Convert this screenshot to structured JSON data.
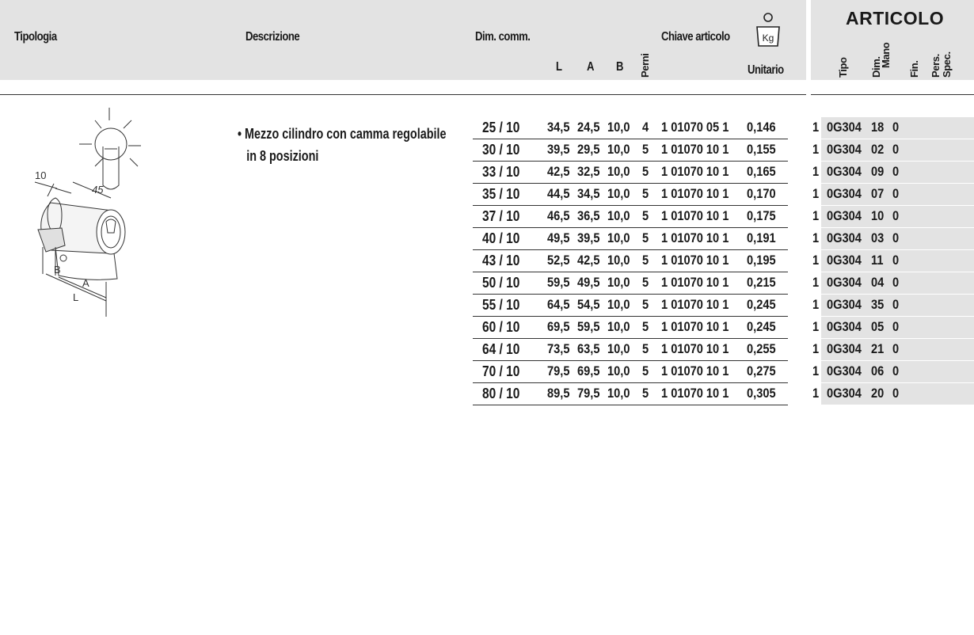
{
  "header": {
    "tipologia": "Tipologia",
    "descrizione": "Descrizione",
    "dim_comm": "Dim. comm.",
    "col_L": "L",
    "col_A": "A",
    "col_B": "B",
    "col_perni": "Perni",
    "chiave_articolo": "Chiave articolo",
    "unitario": "Unitario",
    "kg_icon_label": "Kg",
    "articolo": "ARTICOLO",
    "art_cols": [
      "Tipo",
      "Dim.",
      "Mano",
      "Fin.",
      "Pers.",
      "Spec."
    ]
  },
  "drawing_labels": {
    "dim10": "10",
    "dim45": "45",
    "B": "B",
    "A": "A",
    "L": "L"
  },
  "description": {
    "line1": "• Mezzo cilindro con camma regolabile",
    "line2": "in 8 posizioni"
  },
  "rows": [
    {
      "dim": "25 / 10",
      "L": "34,5",
      "A": "24,5",
      "B": "10,0",
      "perni": "4",
      "chiave": "1 01070 05 1",
      "unitario": "0,146",
      "q": "1",
      "tipo": "0G304",
      "dimart": "18",
      "x": "0"
    },
    {
      "dim": "30 / 10",
      "L": "39,5",
      "A": "29,5",
      "B": "10,0",
      "perni": "5",
      "chiave": "1 01070 10 1",
      "unitario": "0,155",
      "q": "1",
      "tipo": "0G304",
      "dimart": "02",
      "x": "0"
    },
    {
      "dim": "33 / 10",
      "L": "42,5",
      "A": "32,5",
      "B": "10,0",
      "perni": "5",
      "chiave": "1 01070 10 1",
      "unitario": "0,165",
      "q": "1",
      "tipo": "0G304",
      "dimart": "09",
      "x": "0"
    },
    {
      "dim": "35 / 10",
      "L": "44,5",
      "A": "34,5",
      "B": "10,0",
      "perni": "5",
      "chiave": "1 01070 10 1",
      "unitario": "0,170",
      "q": "1",
      "tipo": "0G304",
      "dimart": "07",
      "x": "0"
    },
    {
      "dim": "37 / 10",
      "L": "46,5",
      "A": "36,5",
      "B": "10,0",
      "perni": "5",
      "chiave": "1 01070 10 1",
      "unitario": "0,175",
      "q": "1",
      "tipo": "0G304",
      "dimart": "10",
      "x": "0"
    },
    {
      "dim": "40 / 10",
      "L": "49,5",
      "A": "39,5",
      "B": "10,0",
      "perni": "5",
      "chiave": "1 01070 10 1",
      "unitario": "0,191",
      "q": "1",
      "tipo": "0G304",
      "dimart": "03",
      "x": "0"
    },
    {
      "dim": "43 / 10",
      "L": "52,5",
      "A": "42,5",
      "B": "10,0",
      "perni": "5",
      "chiave": "1 01070 10 1",
      "unitario": "0,195",
      "q": "1",
      "tipo": "0G304",
      "dimart": "11",
      "x": "0"
    },
    {
      "dim": "50 / 10",
      "L": "59,5",
      "A": "49,5",
      "B": "10,0",
      "perni": "5",
      "chiave": "1 01070 10 1",
      "unitario": "0,215",
      "q": "1",
      "tipo": "0G304",
      "dimart": "04",
      "x": "0"
    },
    {
      "dim": "55 / 10",
      "L": "64,5",
      "A": "54,5",
      "B": "10,0",
      "perni": "5",
      "chiave": "1 01070 10 1",
      "unitario": "0,245",
      "q": "1",
      "tipo": "0G304",
      "dimart": "35",
      "x": "0"
    },
    {
      "dim": "60 / 10",
      "L": "69,5",
      "A": "59,5",
      "B": "10,0",
      "perni": "5",
      "chiave": "1 01070 10 1",
      "unitario": "0,245",
      "q": "1",
      "tipo": "0G304",
      "dimart": "05",
      "x": "0"
    },
    {
      "dim": "64 / 10",
      "L": "73,5",
      "A": "63,5",
      "B": "10,0",
      "perni": "5",
      "chiave": "1 01070 10 1",
      "unitario": "0,255",
      "q": "1",
      "tipo": "0G304",
      "dimart": "21",
      "x": "0"
    },
    {
      "dim": "70 / 10",
      "L": "79,5",
      "A": "69,5",
      "B": "10,0",
      "perni": "5",
      "chiave": "1 01070 10 1",
      "unitario": "0,275",
      "q": "1",
      "tipo": "0G304",
      "dimart": "06",
      "x": "0"
    },
    {
      "dim": "80 / 10",
      "L": "89,5",
      "A": "79,5",
      "B": "10,0",
      "perni": "5",
      "chiave": "1 01070 10 1",
      "unitario": "0,305",
      "q": "1",
      "tipo": "0G304",
      "dimart": "20",
      "x": "0"
    }
  ]
}
